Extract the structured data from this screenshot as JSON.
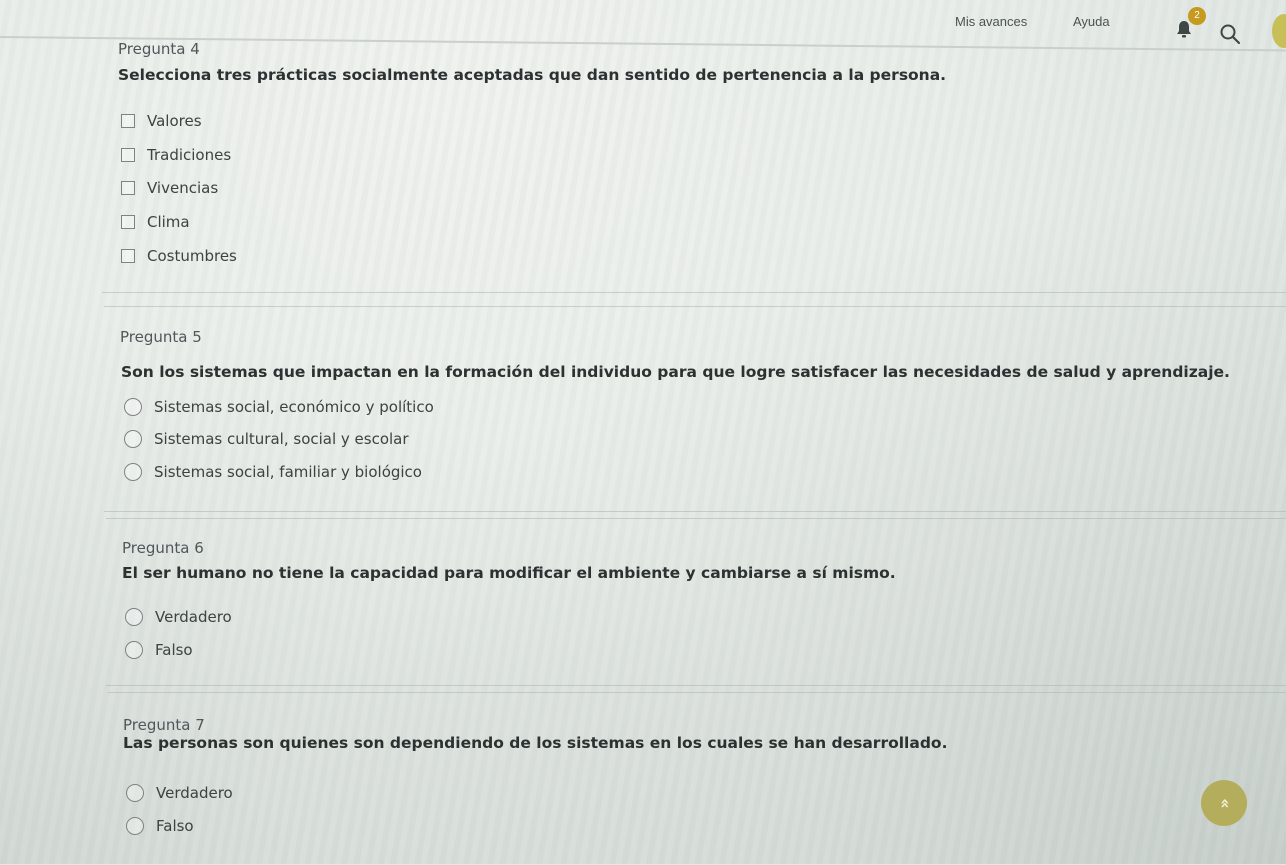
{
  "nav": {
    "progress_label": "Mis avances",
    "help_label": "Ayuda",
    "notification_count": "2"
  },
  "questions": [
    {
      "number": "Pregunta 4",
      "text": "Selecciona tres prácticas socialmente aceptadas que dan sentido de pertenencia a la persona.",
      "type": "checkbox",
      "options": [
        "Valores",
        "Tradiciones",
        "Vivencias",
        "Clima",
        "Costumbres"
      ]
    },
    {
      "number": "Pregunta 5",
      "text": "Son los sistemas que impactan en la formación del individuo para que logre satisfacer las necesidades de salud y aprendizaje.",
      "type": "radio",
      "options": [
        "Sistemas social, económico y político",
        "Sistemas cultural, social y escolar",
        "Sistemas social, familiar y biológico"
      ]
    },
    {
      "number": "Pregunta 6",
      "text": "El ser humano no tiene la capacidad para modificar el ambiente y cambiarse a sí mismo.",
      "type": "radio",
      "options": [
        "Verdadero",
        "Falso"
      ]
    },
    {
      "number": "Pregunta 7",
      "text": "Las personas son quienes son dependiendo de los sistemas en los cuales se han desarrollado.",
      "type": "radio",
      "options": [
        "Verdadero",
        "Falso"
      ]
    }
  ],
  "scroll_top_glyph": "»",
  "colors": {
    "badge": "#c59a1e",
    "scroll_button": "#b4ad5b"
  }
}
